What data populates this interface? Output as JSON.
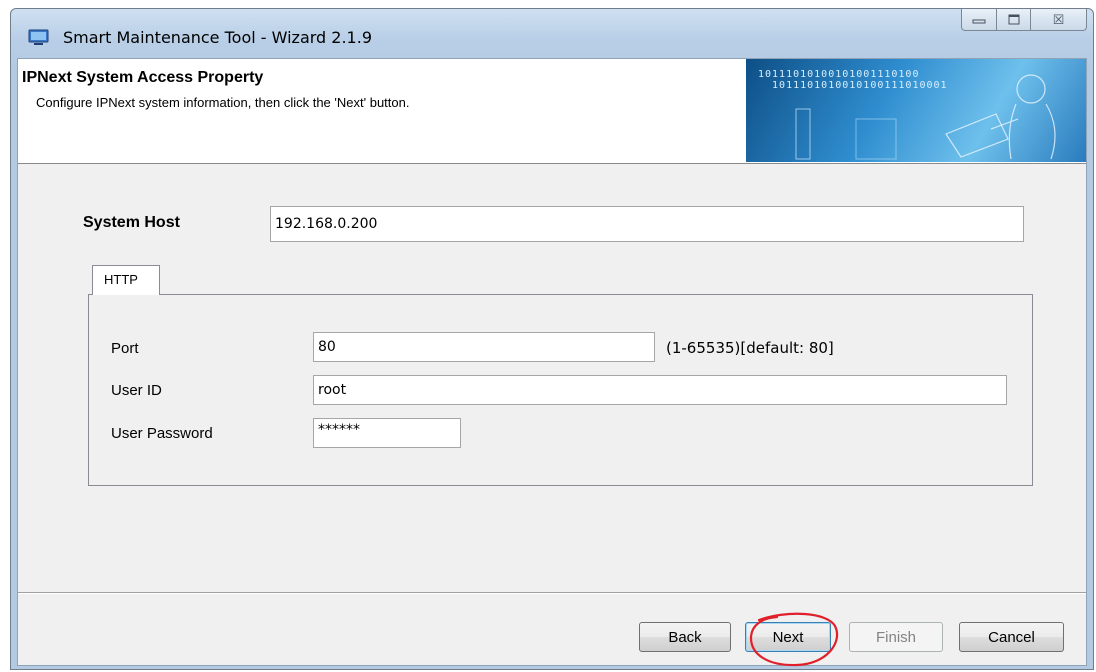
{
  "window": {
    "title": "Smart Maintenance Tool - Wizard 2.1.9",
    "controls": {
      "minimize_icon": "minimize-icon",
      "maximize_icon": "maximize-icon",
      "close_glyph": "☒"
    }
  },
  "header": {
    "title": "IPNext System Access Property",
    "subtitle": "Configure IPNext system information, then click the 'Next' button.",
    "banner_bits": "10111010100101001110100\n  1011101010010100111010001"
  },
  "form": {
    "system_host_label": "System Host",
    "system_host_value": "192.168.0.200",
    "tab_label": "HTTP",
    "port_label": "Port",
    "port_value": "80",
    "port_hint": "(1-65535)[default: 80]",
    "user_id_label": "User ID",
    "user_id_value": "root",
    "password_label": "User Password",
    "password_value": "******"
  },
  "buttons": {
    "back": "Back",
    "next": "Next",
    "finish": "Finish",
    "cancel": "Cancel"
  },
  "colors": {
    "annotation_circle": "#e0202a",
    "banner_accent": "#2f8dcf"
  }
}
